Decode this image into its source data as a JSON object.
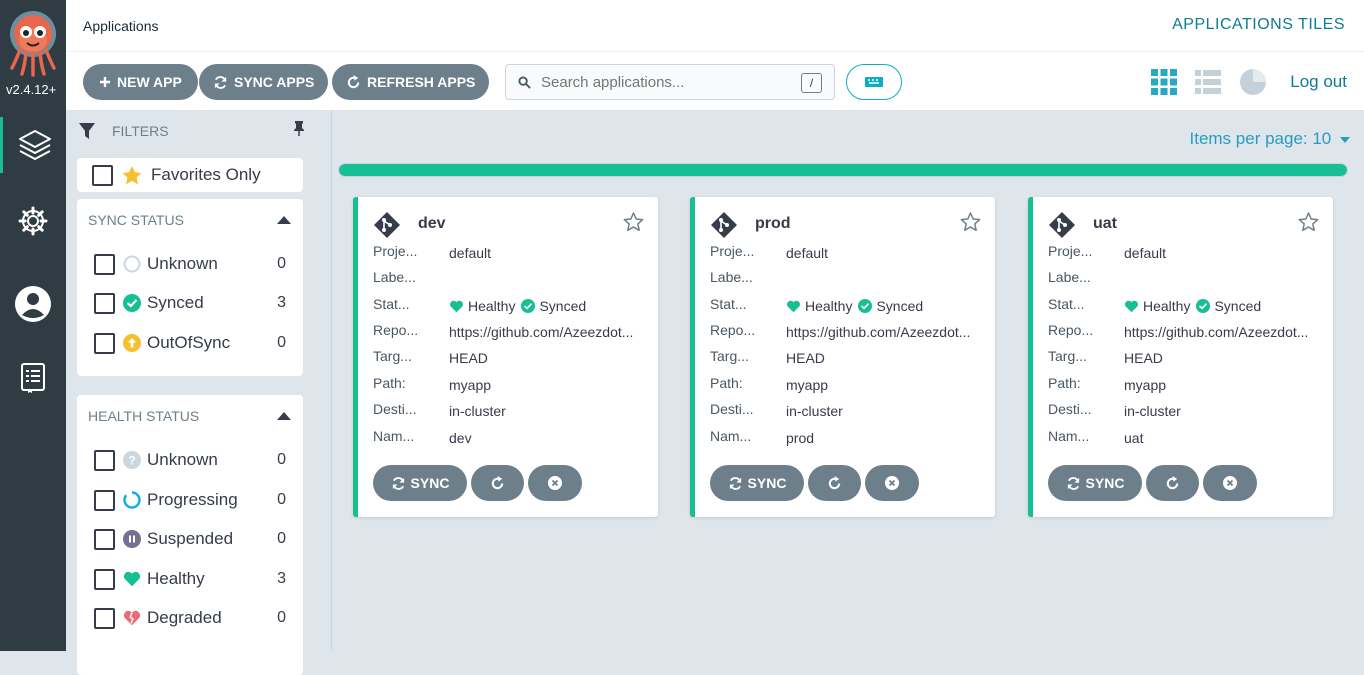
{
  "nav": {
    "version": "v2.4.12+",
    "items": [
      {
        "name": "applications",
        "icon": "layers-icon",
        "active": true
      },
      {
        "name": "settings",
        "icon": "gear-icon"
      },
      {
        "name": "user-info",
        "icon": "user-icon"
      },
      {
        "name": "documentation",
        "icon": "book-icon"
      }
    ]
  },
  "header": {
    "breadcrumb": "Applications",
    "title": "APPLICATIONS TILES"
  },
  "toolbar": {
    "new_app": "NEW APP",
    "sync_apps": "SYNC APPS",
    "refresh_apps": "REFRESH APPS",
    "search_placeholder": "Search applications...",
    "search_shortcut": "/",
    "logout": "Log out",
    "views": [
      "tiles-view-icon",
      "list-view-icon",
      "summary-pie-icon"
    ]
  },
  "filters": {
    "header": "FILTERS",
    "favorites_label": "Favorites Only",
    "sync_status": {
      "title": "SYNC STATUS",
      "items": [
        {
          "label": "Unknown",
          "count": "0"
        },
        {
          "label": "Synced",
          "count": "3"
        },
        {
          "label": "OutOfSync",
          "count": "0"
        }
      ]
    },
    "health_status": {
      "title": "HEALTH STATUS",
      "items": [
        {
          "label": "Unknown",
          "count": "0"
        },
        {
          "label": "Progressing",
          "count": "0"
        },
        {
          "label": "Suspended",
          "count": "0"
        },
        {
          "label": "Healthy",
          "count": "3"
        },
        {
          "label": "Degraded",
          "count": "0"
        }
      ]
    }
  },
  "main": {
    "items_per_page": "Items per page: 10",
    "progress": 1.0,
    "row_keys": [
      "Proje...",
      "Labe...",
      "Stat...",
      "Repo...",
      "Targ...",
      "Path:",
      "Desti...",
      "Nam..."
    ],
    "sync_label": "SYNC",
    "apps": [
      {
        "name": "dev",
        "project": "default",
        "labels": "",
        "health": "Healthy",
        "sync": "Synced",
        "repo": "https://github.com/Azeezdot...",
        "target": "HEAD",
        "path": "myapp",
        "destination": "in-cluster",
        "namespace": "dev"
      },
      {
        "name": "prod",
        "project": "default",
        "labels": "",
        "health": "Healthy",
        "sync": "Synced",
        "repo": "https://github.com/Azeezdot...",
        "target": "HEAD",
        "path": "myapp",
        "destination": "in-cluster",
        "namespace": "prod"
      },
      {
        "name": "uat",
        "project": "default",
        "labels": "",
        "health": "Healthy",
        "sync": "Synced",
        "repo": "https://github.com/Azeezdot...",
        "target": "HEAD",
        "path": "myapp",
        "destination": "in-cluster",
        "namespace": "uat"
      }
    ]
  },
  "colors": {
    "accent": "#18be94",
    "link": "#0d7b95",
    "button": "#6d7f8b",
    "degraded": "#e96d76",
    "outofsync": "#f4c030",
    "suspended": "#766f94",
    "progressing": "#0dadea"
  }
}
